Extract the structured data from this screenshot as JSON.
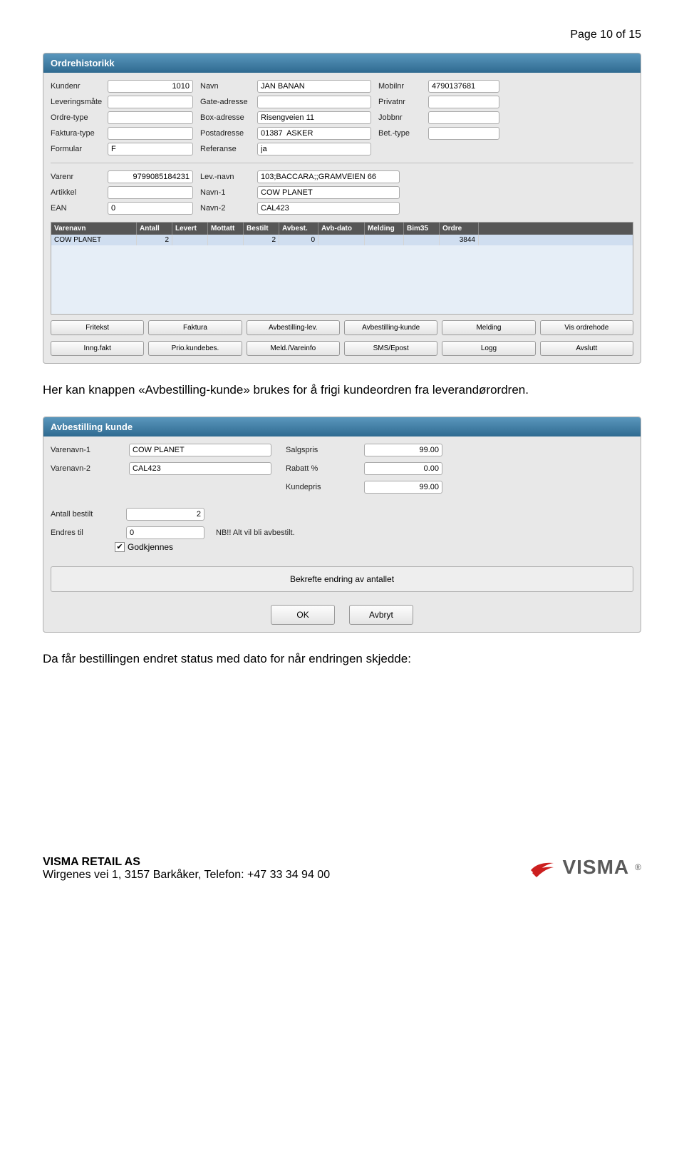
{
  "pageNumber": "Page 10 of 15",
  "panel1": {
    "title": "Ordrehistorikk",
    "fields": {
      "kundenr_lbl": "Kundenr",
      "kundenr": "1010",
      "navn_lbl": "Navn",
      "navn": "JAN BANAN",
      "mobilnr_lbl": "Mobilnr",
      "mobilnr": "4790137681",
      "lev_lbl": "Leveringsmåte",
      "lev": "",
      "gate_lbl": "Gate-adresse",
      "gate": "",
      "privatnr_lbl": "Privatnr",
      "privatnr": "",
      "ordretype_lbl": "Ordre-type",
      "ordretype": "",
      "box_lbl": "Box-adresse",
      "box": "Risengveien 11",
      "jobbnr_lbl": "Jobbnr",
      "jobbnr": "",
      "fakturatype_lbl": "Faktura-type",
      "fakturatype": "",
      "post_lbl": "Postadresse",
      "post": "01387  ASKER",
      "bettype_lbl": "Bet.-type",
      "bettype": "",
      "formular_lbl": "Formular",
      "formular": "F",
      "ref_lbl": "Referanse",
      "ref": "ja",
      "varenr_lbl": "Varenr",
      "varenr": "9799085184231",
      "levnavn_lbl": "Lev.-navn",
      "levnavn": "103;BACCARA;;GRAMVEIEN 66",
      "artikkel_lbl": "Artikkel",
      "artikkel": "",
      "navn1_lbl": "Navn-1",
      "navn1": "COW PLANET",
      "ean_lbl": "EAN",
      "ean": "0",
      "navn2_lbl": "Navn-2",
      "navn2": "CAL423"
    },
    "gridHeaders": [
      "Varenavn",
      "Antall",
      "Levert",
      "Mottatt",
      "Bestilt",
      "Avbest.",
      "Avb-dato",
      "Melding",
      "Bim35",
      "Ordre"
    ],
    "gridRow": [
      "COW PLANET",
      "2",
      "",
      "",
      "2",
      "0",
      "",
      "",
      "",
      "3844"
    ],
    "buttons1": [
      "Fritekst",
      "Faktura",
      "Avbestilling-lev.",
      "Avbestilling-kunde",
      "Melding",
      "Vis ordrehode"
    ],
    "buttons2": [
      "Inng.fakt",
      "Prio.kundebes.",
      "Meld./Vareinfo",
      "SMS/Epost",
      "Logg",
      "Avslutt"
    ]
  },
  "para1": "Her kan knappen «Avbestilling-kunde» brukes for å frigi kundeordren fra leverandørordren.",
  "panel2": {
    "title": "Avbestilling kunde",
    "varenavn1_lbl": "Varenavn-1",
    "varenavn1": "COW PLANET",
    "salgspris_lbl": "Salgspris",
    "salgspris": "99.00",
    "varenavn2_lbl": "Varenavn-2",
    "varenavn2": "CAL423",
    "rabatt_lbl": "Rabatt %",
    "rabatt": "0.00",
    "kundepris_lbl": "Kundepris",
    "kundepris": "99.00",
    "antall_lbl": "Antall bestilt",
    "antall": "2",
    "endres_lbl": "Endres til",
    "endres": "0",
    "nb": "NB!! Alt vil bli avbestilt.",
    "godkjennes": "Godkjennes",
    "banner": "Bekrefte endring av antallet",
    "ok": "OK",
    "avbryt": "Avbryt"
  },
  "para2": "Da får bestillingen endret status med dato for når endringen skjedde:",
  "footer": {
    "company": "VISMA RETAIL AS",
    "address": "Wirgenes vei 1, 3157 Barkåker, Telefon: +47 33 34 94 00",
    "logo": "VISMA"
  }
}
